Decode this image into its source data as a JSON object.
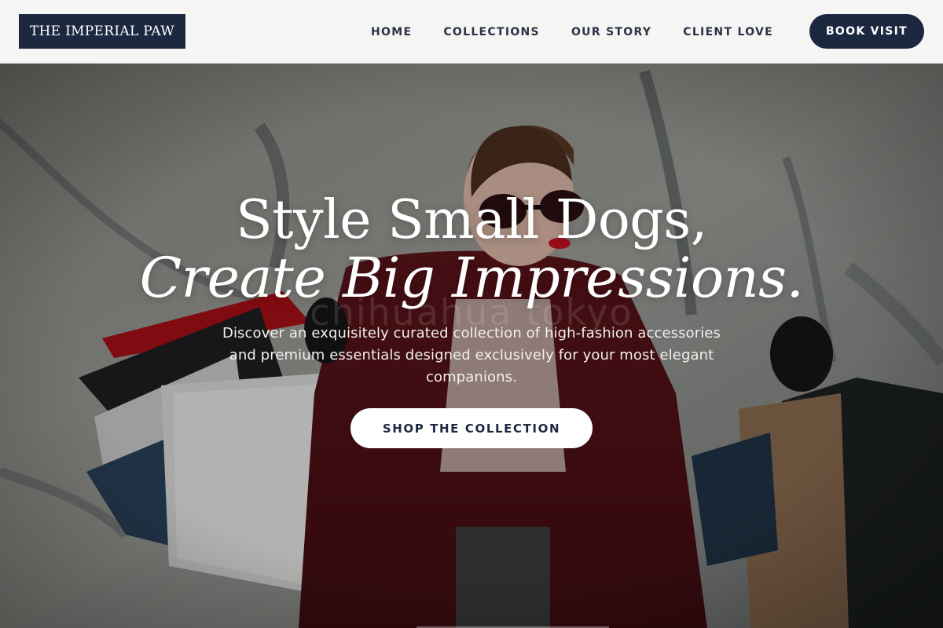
{
  "brand": {
    "logo_text": "THE IMPERIAL PAW"
  },
  "nav": {
    "items": [
      {
        "label": "HOME"
      },
      {
        "label": "COLLECTIONS"
      },
      {
        "label": "OUR STORY"
      },
      {
        "label": "CLIENT LOVE"
      }
    ],
    "cta_label": "BOOK VISIT"
  },
  "hero": {
    "title_line1": "Style Small Dogs,",
    "title_line2": "Create Big Impressions.",
    "watermark": "chihuahua tokyo",
    "subtitle": "Discover an exquisitely curated collection of high-fashion accessories and premium essentials designed exclusively for your most elegant companions.",
    "cta_label": "SHOP THE COLLECTION"
  },
  "colors": {
    "brand_navy": "#1c2840",
    "nav_bg": "#f5f5f4",
    "coat_red": "#6e1a22",
    "button_white": "#ffffff"
  }
}
